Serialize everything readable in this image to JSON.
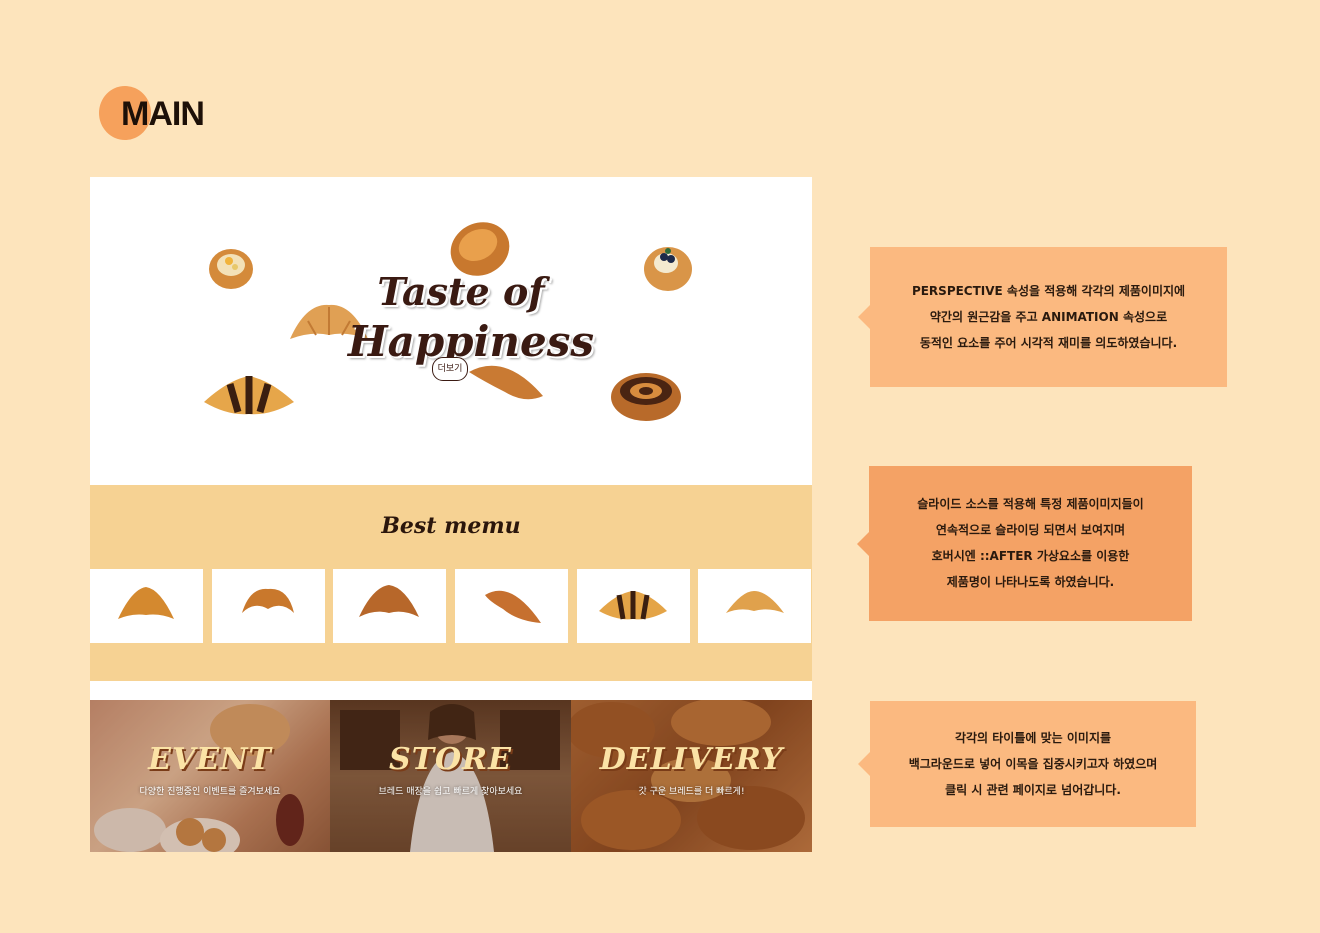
{
  "section": {
    "title": "MAIN"
  },
  "hero": {
    "title_line1": "Taste of",
    "title_line2": "Happiness",
    "more_button": "더보기"
  },
  "best_menu": {
    "title": "Best memu",
    "items": [
      "croissant",
      "croissant",
      "croissant",
      "croissant",
      "chocolate croissant",
      "croissant"
    ]
  },
  "banners": [
    {
      "title": "EVENT",
      "subtitle": "다양한 진행중인 이벤트를 즐겨보세요"
    },
    {
      "title": "STORE",
      "subtitle": "브레드 매장을 쉽고 빠르게 찾아보세요"
    },
    {
      "title": "DELIVERY",
      "subtitle": "갓 구운 브레드를 더 빠르게!"
    }
  ],
  "notes": [
    {
      "lines": [
        "PERSPECTIVE 속성을 적용해 각각의 제품이미지에",
        "약간의 원근감을 주고 ANIMATION 속성으로",
        "동적인 요소를 주어 시각적 재미를 의도하였습니다."
      ],
      "color": "#fbb980"
    },
    {
      "lines": [
        "슬라이드 소스를 적용해 특정 제품이미지들이",
        "연속적으로 슬라이딩 되면서 보여지며",
        "호버시엔 ::AFTER 가상요소를 이용한",
        "제품명이 나타나도록 하였습니다."
      ],
      "color": "#f4a265"
    },
    {
      "lines": [
        "각각의 타이틀에 맞는 이미지를",
        "백그라운드로 넣어 이목을 집중시키고자 하였으며",
        "클릭 시 관련 페이지로 넘어갑니다."
      ],
      "color": "#fbb980"
    }
  ]
}
